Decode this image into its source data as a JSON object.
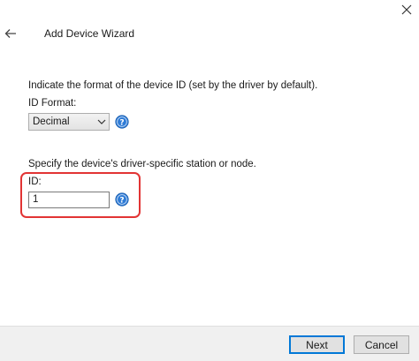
{
  "window": {
    "title": "Add Device Wizard",
    "close_icon": "close-icon",
    "back_icon": "back-arrow-icon"
  },
  "format_section": {
    "prompt": "Indicate the format of the device ID (set by the driver by default).",
    "label": "ID Format:",
    "selected": "Decimal",
    "help_icon": "help-icon"
  },
  "id_section": {
    "prompt": "Specify the device's driver-specific station or node.",
    "label": "ID:",
    "value": "1",
    "help_icon": "help-icon"
  },
  "buttons": {
    "next": "Next",
    "cancel": "Cancel"
  },
  "colors": {
    "highlight": "#e23434",
    "help_blue": "#2e7bd6",
    "default_button_border": "#0078d7"
  }
}
